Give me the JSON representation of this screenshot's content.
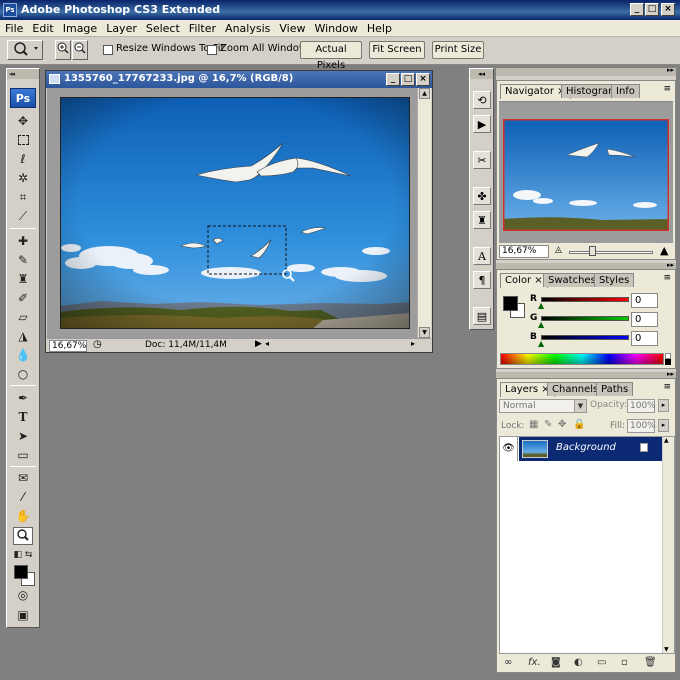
{
  "app": {
    "title": "Adobe Photoshop CS3 Extended",
    "icon": "Ps"
  },
  "menu": [
    "File",
    "Edit",
    "Image",
    "Layer",
    "Select",
    "Filter",
    "Analysis",
    "View",
    "Window",
    "Help"
  ],
  "options": {
    "resize_windows_label": "Resize Windows To Fit",
    "zoom_all_label": "Zoom All Windows",
    "actual_pixels": "Actual Pixels",
    "fit_screen": "Fit Screen",
    "print_size": "Print Size"
  },
  "toolbox": {
    "logo": "Ps"
  },
  "document": {
    "title": "1355760_17767233.jpg @ 16,7% (RGB/8)",
    "zoom": "16,67%",
    "doc_size": "Doc: 11,4M/11,4M"
  },
  "navigator": {
    "tabs": [
      "Navigator",
      "Histogram",
      "Info"
    ],
    "zoom": "16,67%"
  },
  "color": {
    "tabs": [
      "Color",
      "Swatches",
      "Styles"
    ],
    "channels": [
      {
        "label": "R",
        "value": "0"
      },
      {
        "label": "G",
        "value": "0"
      },
      {
        "label": "B",
        "value": "0"
      }
    ]
  },
  "layers": {
    "tabs": [
      "Layers",
      "Channels",
      "Paths"
    ],
    "blend_mode": "Normal",
    "opacity_label": "Opacity:",
    "opacity": "100%",
    "lock_label": "Lock:",
    "fill_label": "Fill:",
    "fill": "100%",
    "layer_name": "Background"
  },
  "colors": {
    "accent": "#0a246a",
    "layer_selected": "#0b2a73",
    "sky": "#1e7fd0"
  }
}
